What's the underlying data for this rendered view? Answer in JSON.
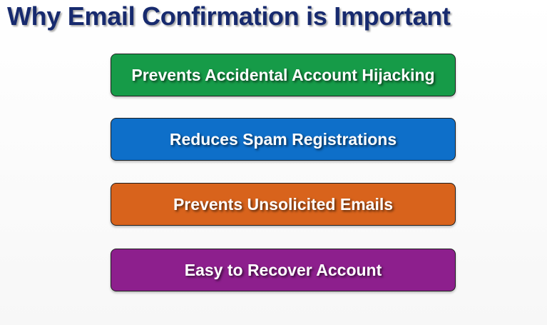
{
  "slide": {
    "title": "Why Email Confirmation is Important",
    "items": [
      {
        "label": "Prevents Accidental Account Hijacking",
        "color": "#169b48"
      },
      {
        "label": "Reduces Spam Registrations",
        "color": "#0e6fc9"
      },
      {
        "label": "Prevents Unsolicited Emails",
        "color": "#d8631c"
      },
      {
        "label": "Easy to Recover Account",
        "color": "#8d1f8d"
      }
    ]
  }
}
